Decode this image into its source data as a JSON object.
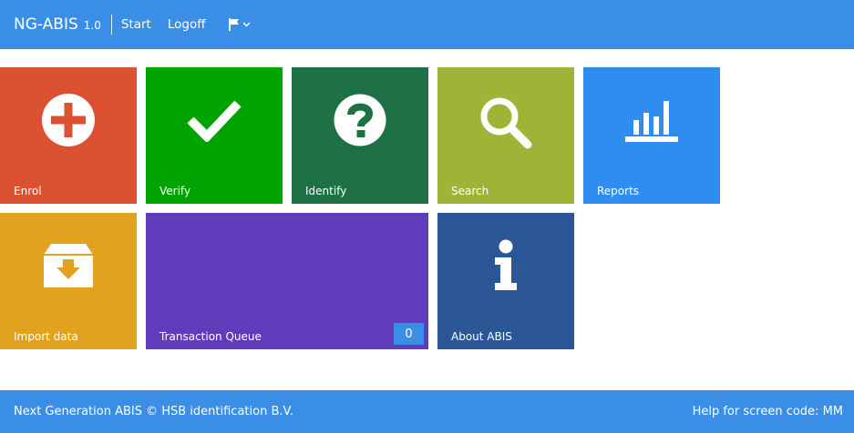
{
  "header": {
    "brand": "NG-ABIS",
    "version": "1.0",
    "nav": {
      "start": "Start",
      "logoff": "Logoff"
    },
    "language_icon": "flag-icon"
  },
  "tiles": {
    "enrol": {
      "label": "Enrol",
      "color": "#dc5230",
      "icon": "plus-circle-icon"
    },
    "verify": {
      "label": "Verify",
      "color": "#00a300",
      "icon": "check-icon"
    },
    "identify": {
      "label": "Identify",
      "color": "#1e7145",
      "icon": "question-circle-icon"
    },
    "search": {
      "label": "Search",
      "color": "#9fb337",
      "icon": "search-icon"
    },
    "reports": {
      "label": "Reports",
      "color": "#2e8def",
      "icon": "bar-chart-icon"
    },
    "import": {
      "label": "Import data",
      "color": "#e2a11f",
      "icon": "inbox-download-icon"
    },
    "queue": {
      "label": "Transaction Queue",
      "color": "#603cba",
      "count": "0"
    },
    "about": {
      "label": "About ABIS",
      "color": "#2b5797",
      "icon": "info-icon"
    }
  },
  "footer": {
    "copyright": "Next Generation ABIS © HSB identification B.V.",
    "help": "Help for screen code: MM"
  }
}
